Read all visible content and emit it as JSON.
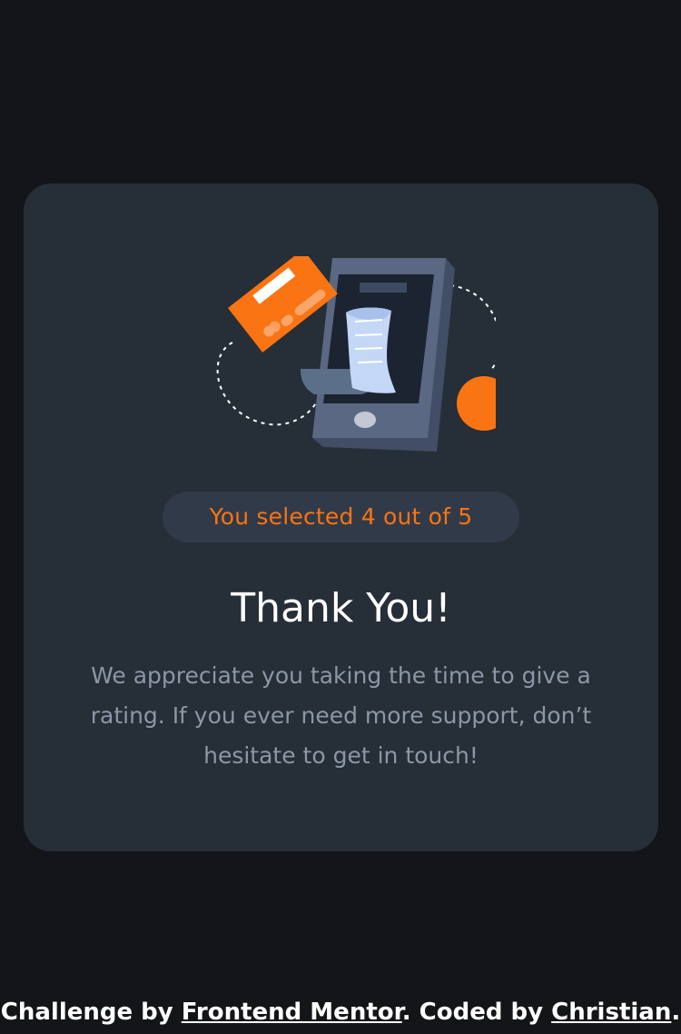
{
  "card": {
    "illustration_icon": "phone-payment-illustration",
    "selection_badge": "You selected 4 out of 5",
    "title": "Thank You!",
    "message": "We appreciate you taking the time to give a rating. If you ever need more support, don’t hesitate to get in touch!"
  },
  "footer": {
    "prefix": "Challenge by ",
    "challenge_link": "Frontend Mentor",
    "middle": ". Coded by ",
    "author_link": "Christian",
    "suffix": "."
  },
  "colors": {
    "page_background": "#131518",
    "card_background": "#262e38",
    "badge_background": "#313a48",
    "accent_orange": "#fb7413",
    "body_text": "#8c97a6",
    "heading_text": "#ffffff"
  }
}
